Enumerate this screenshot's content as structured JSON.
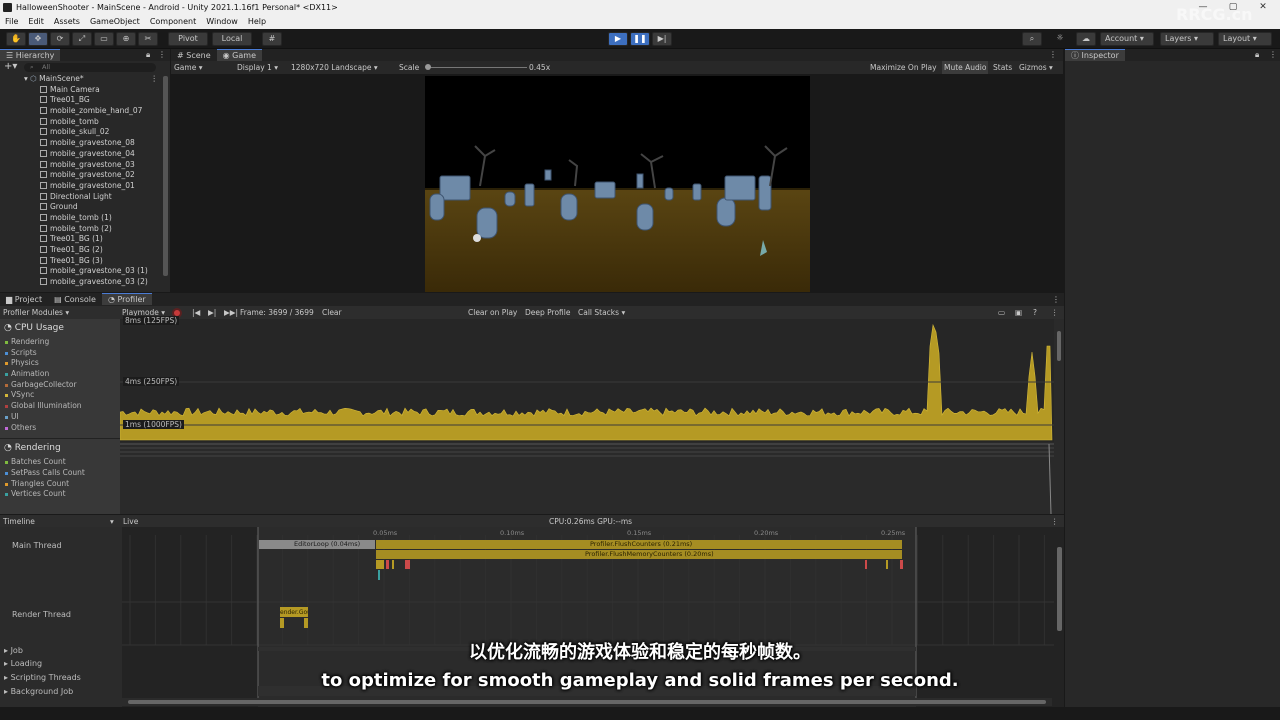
{
  "window": {
    "title": "HalloweenShooter - MainScene - Android - Unity 2021.1.16f1 Personal* <DX11>"
  },
  "menu": [
    "File",
    "Edit",
    "Assets",
    "GameObject",
    "Component",
    "Window",
    "Help"
  ],
  "toolbar": {
    "pivot": "Pivot",
    "local": "Local",
    "account": "Account",
    "layers": "Layers",
    "layout": "Layout"
  },
  "hierarchy": {
    "tab": "Hierarchy",
    "search_placeholder": "All",
    "scene": "MainScene*",
    "items": [
      "Main Camera",
      "Tree01_BG",
      "mobile_zombie_hand_07",
      "mobile_tomb",
      "mobile_skull_02",
      "mobile_gravestone_08",
      "mobile_gravestone_04",
      "mobile_gravestone_03",
      "mobile_gravestone_02",
      "mobile_gravestone_01",
      "Directional Light",
      "Ground",
      "mobile_tomb (1)",
      "mobile_tomb (2)",
      "Tree01_BG (1)",
      "Tree01_BG (2)",
      "Tree01_BG (3)",
      "mobile_gravestone_03 (1)",
      "mobile_gravestone_03 (2)"
    ]
  },
  "game": {
    "tab_scene": "Scene",
    "tab_game": "Game",
    "game_dropdown": "Game",
    "display": "Display 1",
    "resolution": "1280x720 Landscape",
    "scale_label": "Scale",
    "scale_value": "0.45x",
    "maximize": "Maximize On Play",
    "mute": "Mute Audio",
    "stats": "Stats",
    "gizmos": "Gizmos"
  },
  "inspector": {
    "tab": "Inspector"
  },
  "bottom_tabs": {
    "project": "Project",
    "console": "Console",
    "profiler": "Profiler"
  },
  "profiler": {
    "modules": "Profiler Modules",
    "playmode": "Playmode",
    "frame": "Frame: 3699 / 3699",
    "clear": "Clear",
    "clear_on_play": "Clear on Play",
    "deep_profile": "Deep Profile",
    "call_stacks": "Call Stacks",
    "cpu_title": "CPU Usage",
    "cpu_items": [
      {
        "label": "Rendering",
        "color": "#7fba3f"
      },
      {
        "label": "Scripts",
        "color": "#4c8fd6"
      },
      {
        "label": "Physics",
        "color": "#e09a2c"
      },
      {
        "label": "Animation",
        "color": "#3aa0a0"
      },
      {
        "label": "GarbageCollector",
        "color": "#b36b3a"
      },
      {
        "label": "VSync",
        "color": "#d4b73a"
      },
      {
        "label": "Global Illumination",
        "color": "#b04040"
      },
      {
        "label": "UI",
        "color": "#6aa0c8"
      },
      {
        "label": "Others",
        "color": "#c06ad8"
      }
    ],
    "rendering_title": "Rendering",
    "rendering_items": [
      {
        "label": "Batches Count",
        "color": "#7fba3f"
      },
      {
        "label": "SetPass Calls Count",
        "color": "#4c8fd6"
      },
      {
        "label": "Triangles Count",
        "color": "#e09a2c"
      },
      {
        "label": "Vertices Count",
        "color": "#3aa0a0"
      }
    ],
    "chart_top_label": "8ms (125FPS)",
    "chart_mid_label": "4ms (250FPS)",
    "chart_low_label": "1ms (1000FPS)",
    "timeline": "Timeline",
    "live": "Live",
    "cpu_gpu": "CPU:0.26ms   GPU:--ms",
    "ruler": [
      "0.05ms",
      "0.10ms",
      "0.15ms",
      "0.20ms",
      "0.25ms"
    ],
    "main_thread": "Main Thread",
    "render_thread": "Render Thread",
    "bars": {
      "editor_loop": "EditorLoop (0.04ms)",
      "flush_counters": "Profiler.FlushCounters (0.21ms)",
      "flush_memory": "Profiler.FlushMemoryCounters (0.20ms)",
      "render_small": "ender.Gou"
    },
    "groups": [
      "Job",
      "Loading",
      "Scripting Threads",
      "Background Job"
    ]
  },
  "subtitles": {
    "cn": "以优化流畅的游戏体验和稳定的每秒帧数。",
    "en": "to optimize for smooth gameplay and solid frames per second."
  },
  "watermark": "RRCG.cn"
}
